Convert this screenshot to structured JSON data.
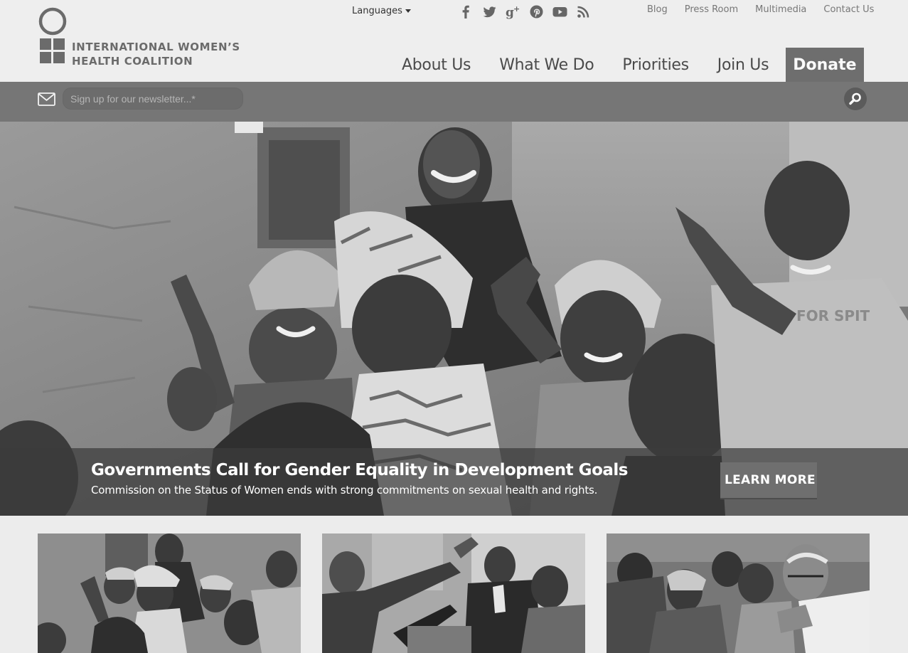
{
  "brand": {
    "name_line1": "INTERNATIONAL WOMEN’S",
    "name_line2": "HEALTH COALITION"
  },
  "topbar": {
    "languages_label": "Languages",
    "social_icons": [
      "facebook-icon",
      "twitter-icon",
      "google-plus-icon",
      "pinterest-icon",
      "youtube-icon",
      "rss-icon"
    ],
    "utility_links": [
      "Blog",
      "Press Room",
      "Multimedia",
      "Contact Us"
    ]
  },
  "nav": {
    "items": [
      "About Us",
      "What We Do",
      "Priorities",
      "Join Us"
    ],
    "donate_label": "Donate"
  },
  "newsletter": {
    "placeholder": "Sign up for our newsletter...*"
  },
  "hero": {
    "title": "Governments Call for Gender Equality in Development Goals",
    "subtitle": "Commission on the Status of Women ends with strong commitments on sexual health and rights.",
    "cta_label": "LEARN MORE"
  },
  "colors": {
    "header_bg": "#eeeeee",
    "newsbar_bg": "#767676",
    "donate_bg": "#6e6e6e",
    "caption_bg": "#3c3c3c",
    "text_dark": "#4a4a4a"
  }
}
